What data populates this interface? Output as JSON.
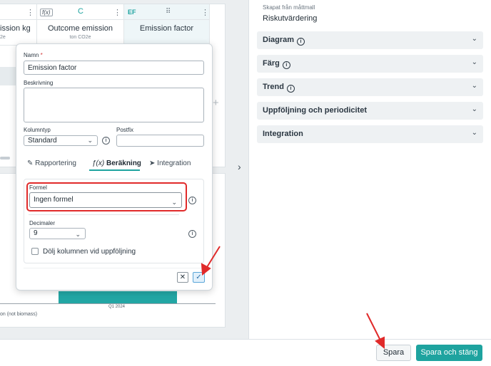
{
  "grid": {
    "columns": [
      {
        "tag": "",
        "title": "ission kg",
        "unit": "2e"
      },
      {
        "tag": "f(x)",
        "letter": "C",
        "title": "Outcome emission",
        "unit": "ton CO2e"
      },
      {
        "tag": "EF",
        "title": "Emission factor",
        "unit": ""
      }
    ]
  },
  "chart": {
    "tick_label": "Q1 2024",
    "legend_label": "on (not biomass)",
    "bar_color": "#22a6a4"
  },
  "right_panel": {
    "template_label": "Skapat från måttmall",
    "template_value": "Riskutvärdering",
    "accordions": [
      {
        "label": "Diagram",
        "info": true
      },
      {
        "label": "Färg",
        "info": true
      },
      {
        "label": "Trend",
        "info": true
      },
      {
        "label": "Uppföljning och periodicitet",
        "info": false
      },
      {
        "label": "Integration",
        "info": false
      }
    ]
  },
  "popover": {
    "name_label": "Namn",
    "name_required": "*",
    "name_value": "Emission factor",
    "description_label": "Beskrivning",
    "description_value": "",
    "column_type_label": "Kolumntyp",
    "column_type_value": "Standard",
    "postfix_label": "Postfix",
    "postfix_value": "",
    "tabs": [
      {
        "label": "Rapportering",
        "icon": "edit-icon",
        "active": false
      },
      {
        "label": "Beräkning",
        "icon": "function-icon",
        "active": true
      },
      {
        "label": "Integration",
        "icon": "send-icon",
        "active": false
      }
    ],
    "formula_label": "Formel",
    "formula_value": "Ingen formel",
    "decimals_label": "Decimaler",
    "decimals_value": "9",
    "hide_column_label": "Dölj kolumnen vid uppföljning"
  },
  "footer": {
    "save_label": "Spara",
    "save_close_label": "Spara och stäng",
    "accent_color": "#1ea39f"
  }
}
